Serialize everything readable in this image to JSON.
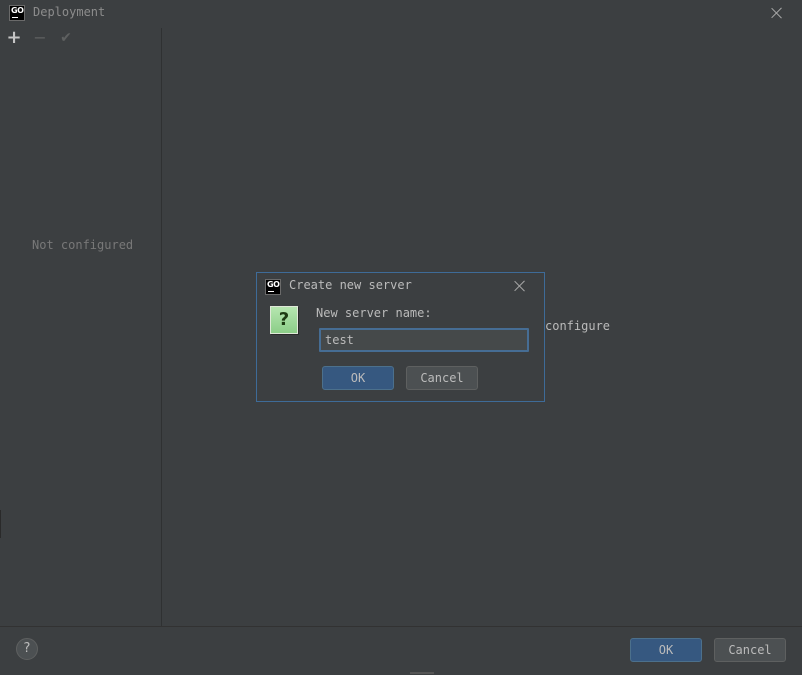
{
  "window": {
    "title": "Deployment",
    "app_icon": "goland-icon",
    "close_icon": "close-icon"
  },
  "toolbar": {
    "add": "+",
    "remove": "−",
    "apply": "✔"
  },
  "sidebar": {
    "empty_text": "Not configured"
  },
  "main": {
    "configure_text": "configure"
  },
  "footer": {
    "help": "?",
    "ok_label": "OK",
    "cancel_label": "Cancel"
  },
  "modal": {
    "title": "Create new server",
    "question_icon": "?",
    "field_label": "New server name:",
    "field_value": "test",
    "ok_label": "OK",
    "cancel_label": "Cancel"
  },
  "colors": {
    "background": "#3c3f41",
    "accent_border": "#3e6b98",
    "primary_button": "#365880"
  }
}
